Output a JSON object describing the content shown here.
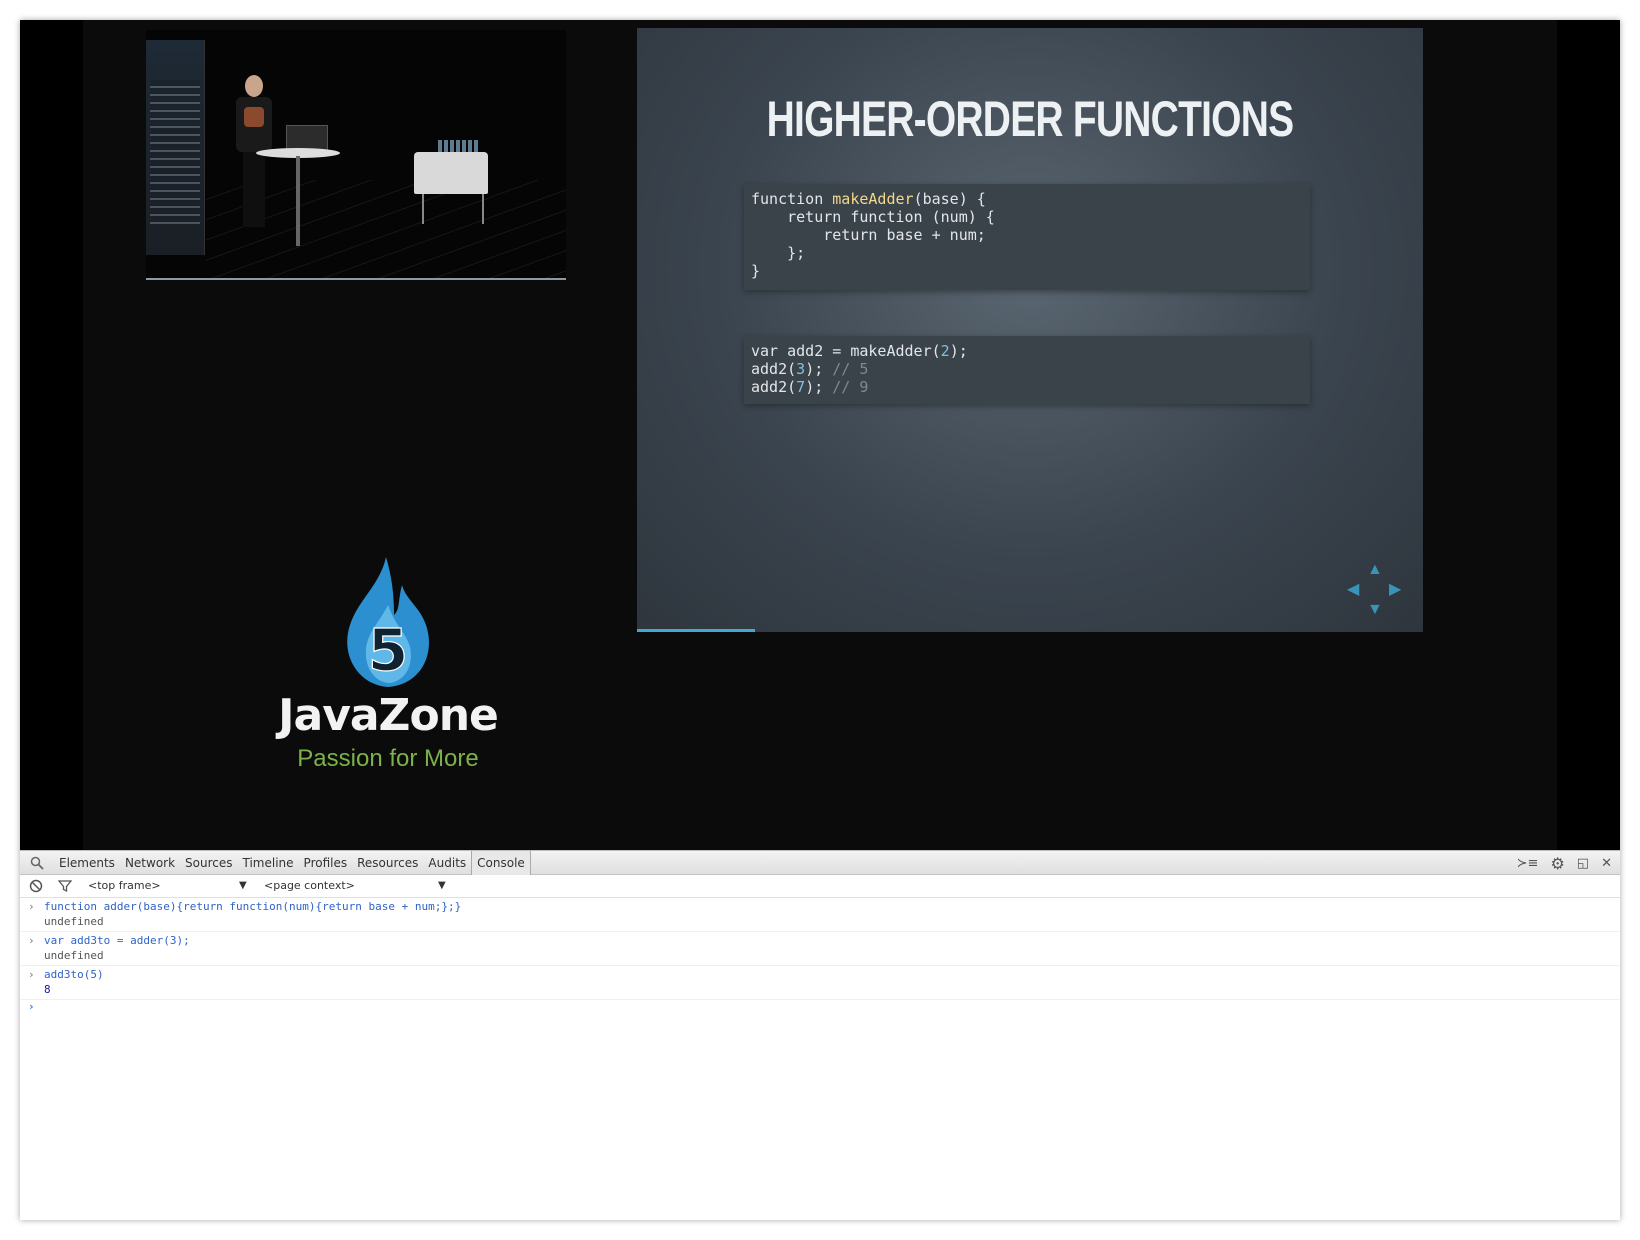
{
  "slide": {
    "title": "HIGHER-ORDER FUNCTIONS",
    "code1": {
      "l1a": "function ",
      "l1b": "makeAdder",
      "l1c": "(base) {",
      "l2": "    return function (num) {",
      "l3": "        return base + num;",
      "l4": "    };",
      "l5": "}"
    },
    "code2": {
      "l1a": "var add2 = makeAdder(",
      "l1b": "2",
      "l1c": ");",
      "l2a": "add2(",
      "l2b": "3",
      "l2c": "); ",
      "l2d": "// 5",
      "l3a": "add2(",
      "l3b": "7",
      "l3c": "); ",
      "l3d": "// 9"
    },
    "progress": 0.15
  },
  "logo": {
    "name": "JavaZone",
    "tagline": "Passion for More"
  },
  "devtools": {
    "tabs": [
      "Elements",
      "Network",
      "Sources",
      "Timeline",
      "Profiles",
      "Resources",
      "Audits",
      "Console"
    ],
    "active_tab": "Console",
    "frame_select": "<top frame>",
    "context_select": "<page context>",
    "console": [
      {
        "input": "function adder(base){return function(num){return base + num;};}",
        "output": "undefined"
      },
      {
        "input": "var add3to = adder(3);",
        "output": "undefined"
      },
      {
        "input": "add3to(5)",
        "output": "8"
      }
    ],
    "prompt": ">"
  },
  "colors": {
    "accent": "#42a8d6",
    "console_input": "#2f63c8",
    "logo_green": "#7bb24a"
  }
}
